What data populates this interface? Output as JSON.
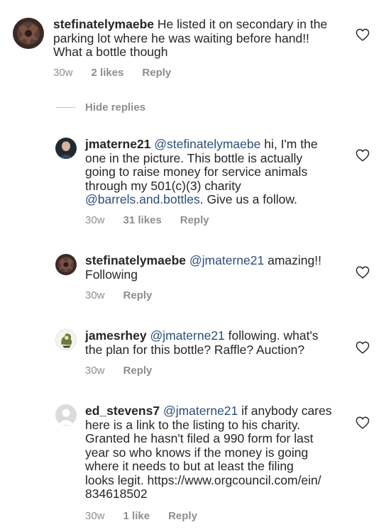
{
  "comments": [
    {
      "username": "stefinatelymaebe",
      "mention": "",
      "text_lines": [
        " He listed it on secondary in the",
        "parking lot where he was waiting before hand!!",
        "What a bottle though"
      ],
      "time": "30w",
      "likes": "2 likes",
      "reply": "Reply"
    },
    {
      "username": "jmaterne21",
      "mention": "@stefinatelymaebe",
      "text_lines": [
        " hi, I'm the",
        "one in the picture. This bottle is actually",
        "going to raise money for service animals",
        "through my 501(c)(3) charity"
      ],
      "link_mention": "@barrels.and.bottles",
      "link_tail": ". Give us a follow.",
      "time": "30w",
      "likes": "31 likes",
      "reply": "Reply"
    },
    {
      "username": "stefinatelymaebe",
      "mention": "@jmaterne21",
      "text_lines": [
        " amazing!!",
        "Following"
      ],
      "time": "30w",
      "reply": "Reply"
    },
    {
      "username": "jamesrhey",
      "mention": "@jmaterne21",
      "text_lines": [
        " following. what's",
        "the plan for this bottle? Raffle? Auction?"
      ],
      "time": "30w",
      "reply": "Reply"
    },
    {
      "username": "ed_stevens7",
      "mention": "@jmaterne21",
      "text_lines": [
        " if anybody cares",
        "here is a link to the listing to his charity.",
        "Granted he hasn't filed a 990 form for last",
        "year so who knows if the money is going",
        "where it needs to but at least the filing",
        "looks legit. https://www.orgcouncil.com/ein/",
        "834618502"
      ],
      "time": "30w",
      "likes": "1 like",
      "reply": "Reply"
    }
  ],
  "hide_replies": "Hide replies",
  "icons": {
    "like": "heart-icon"
  },
  "colors": {
    "mention": "#2b4e7b",
    "meta": "#8e8e8e"
  }
}
